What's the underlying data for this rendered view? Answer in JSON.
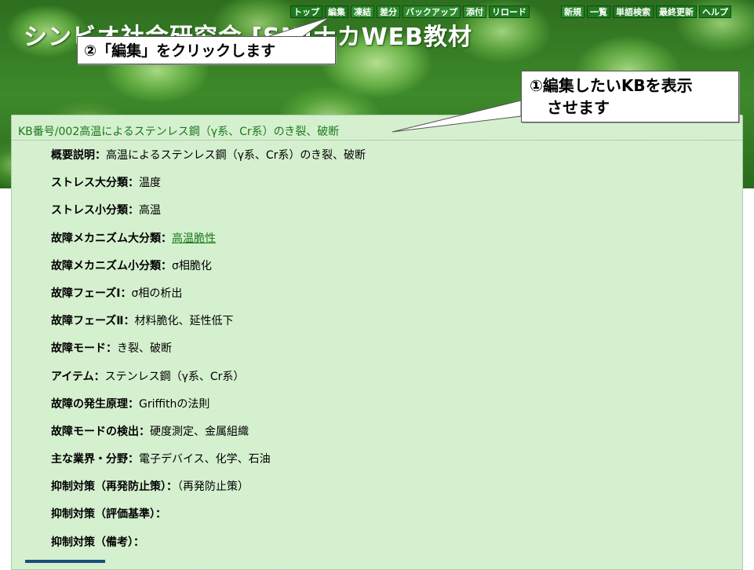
{
  "header": {
    "site_title": "シンビオ社会研究会 [SN]ナカWEB教材"
  },
  "toolbar": {
    "left": [
      {
        "label": "トップ"
      },
      {
        "label": "編集"
      },
      {
        "label": "凍結"
      },
      {
        "label": "差分"
      },
      {
        "label": "バックアップ"
      },
      {
        "label": "添付"
      },
      {
        "label": "リロード"
      }
    ],
    "right": [
      {
        "label": "新規"
      },
      {
        "label": "一覧"
      },
      {
        "label": "単語検索"
      },
      {
        "label": "最終更新"
      },
      {
        "label": "ヘルプ"
      }
    ]
  },
  "callouts": {
    "step1_line1": "①編集したいKBを表示",
    "step1_line2": "させます",
    "step2": "②「編集」をクリックします"
  },
  "kb": {
    "title": "KB番号/002高温によるステンレス鋼（γ系、Cr系）のき裂、破断",
    "fields": [
      {
        "label": "概要説明：",
        "value": "高温によるステンレス鋼（γ系、Cr系）のき裂、破断"
      },
      {
        "label": "ストレス大分類：",
        "value": "温度"
      },
      {
        "label": "ストレス小分類：",
        "value": "高温"
      },
      {
        "label": "故障メカニズム大分類：",
        "value": "高温脆性",
        "link": true
      },
      {
        "label": "故障メカニズム小分類：",
        "value": "σ相脆化"
      },
      {
        "label": "故障フェーズⅠ：",
        "value": "σ相の析出"
      },
      {
        "label": "故障フェーズⅡ：",
        "value": "材料脆化、延性低下"
      },
      {
        "label": "故障モード：",
        "value": "き裂、破断"
      },
      {
        "label": "アイテム：",
        "value": "ステンレス鋼（γ系、Cr系）"
      },
      {
        "label": "故障の発生原理：",
        "value": "Griffithの法則"
      },
      {
        "label": "故障モードの検出：",
        "value": "硬度測定、金属組織"
      },
      {
        "label": "主な業界・分野：",
        "value": "電子デバイス、化学、石油"
      },
      {
        "label": "抑制対策（再発防止策）：",
        "value": "（再発防止策）"
      },
      {
        "label": "抑制対策（評価基準）：",
        "value": ""
      },
      {
        "label": "抑制対策（備考）：",
        "value": ""
      }
    ]
  },
  "colors": {
    "accent_green": "#1a7a1a",
    "panel_bg": "#d5f0cf",
    "toolbar_bg": "#1f7a1f"
  }
}
